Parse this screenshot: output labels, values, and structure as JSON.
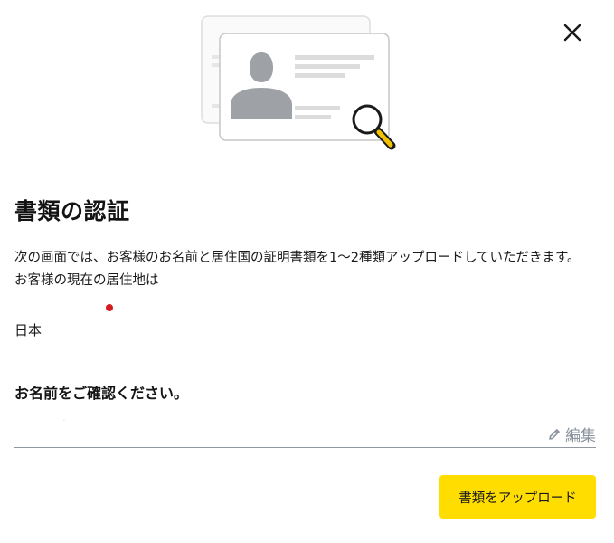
{
  "dialog": {
    "title": "書類の認証",
    "description_line1": "次の画面では、お客様のお名前と居住国の証明書類を1～2種類アップロードしていただきます。",
    "description_line2": "お客様の現在の居住地は",
    "country": "日本",
    "country_flag": "japan-flag",
    "confirm_name_label": "お名前をご確認ください。",
    "name_value": "·",
    "edit_label": "編集",
    "upload_button_label": "書類をアップロード"
  },
  "icons": {
    "close": "close-icon",
    "edit": "pencil-icon",
    "illustration": "id-card-magnifier-illustration"
  },
  "colors": {
    "primary_button": "#ffdd00",
    "magnifier_handle": "#f2c200",
    "flag_red": "#d71920",
    "muted_text": "#8a939d"
  }
}
